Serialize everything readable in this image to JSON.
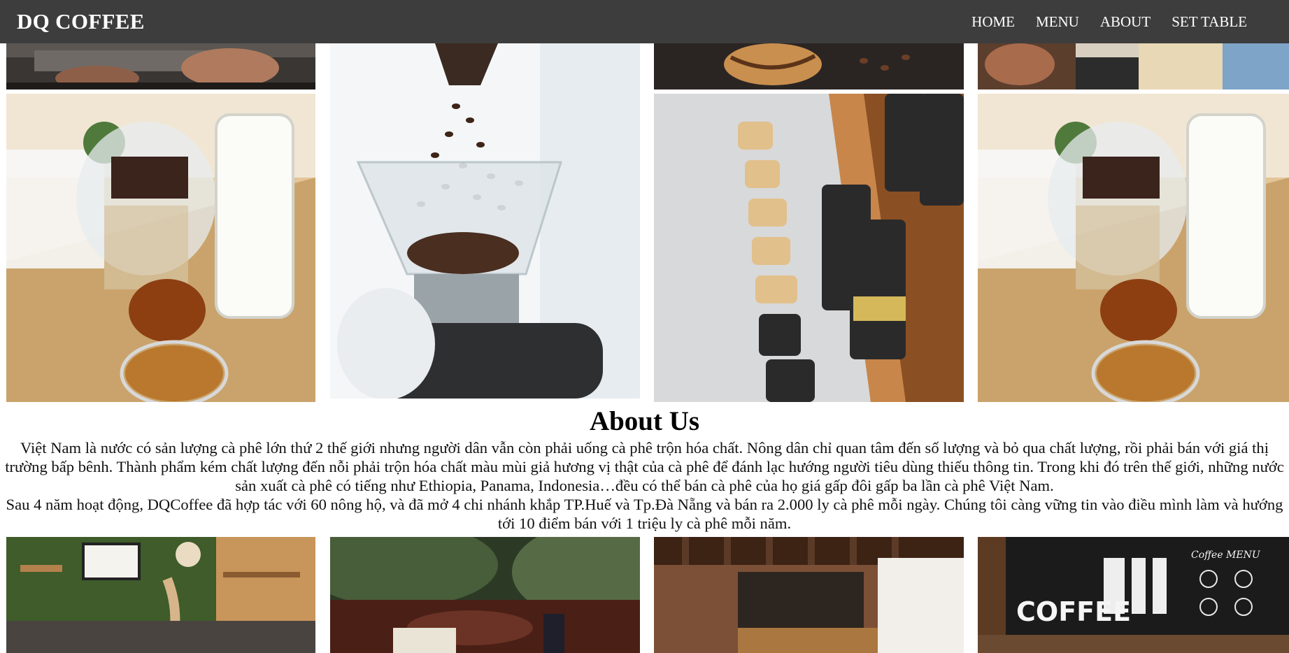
{
  "navbar": {
    "brand": "DQ COFFEE",
    "links": [
      "HOME",
      "MENU",
      "ABOUT",
      "SET TABLE"
    ],
    "background": "#3d3d3d"
  },
  "about": {
    "title": "About Us",
    "paragraph_1": "Việt Nam là nước có sản lượng cà phê lớn thứ 2 thế giới nhưng người dân vẫn còn phải uống cà phê trộn hóa chất. Nông dân chỉ quan tâm đến số lượng và bỏ qua chất lượng, rồi phải bán với giá thị trường bấp bênh. Thành phẩm kém chất lượng đến nỗi phải trộn hóa chất màu mùi giả hương vị thật của cà phê để đánh lạc hướng người tiêu dùng thiếu thông tin. Trong khi đó trên thế giới, những nước sản xuất cà phê có tiếng như Ethiopia, Panama, Indonesia…đều có thể bán cà phê của họ giá gấp đôi gấp ba lần cà phê Việt Nam.",
    "paragraph_2": "Sau 4 năm hoạt động, DQCoffee đã hợp tác với 60 nông hộ, và đã mở 4 chi nhánh khắp TP.Huế và Tp.Đà Nẵng và bán ra 2.000 ly cà phê mỗi ngày. Chúng tôi càng vững tin vào điều mình làm và hướng tới 10 điểm bán với 1 triệu ly cà phê mỗi năm."
  },
  "gallery": {
    "top_row": [
      "barista-hands-photo",
      "coffee-beans-grinder-photo",
      "croissant-beans-photo",
      "cashier-counter-photo"
    ],
    "middle_row": [
      "dessert-milk-tray-photo",
      "coffee-bean-pouring-photo",
      "coffee-bags-shelf-photo",
      "dessert-milk-tray-photo"
    ],
    "bottom_row": [
      "green-wall-cafe-interior-photo",
      "garden-terrace-table-photo",
      "brick-cafe-bar-photo",
      "chalkboard-coffee-menu-photo"
    ]
  },
  "photo_text": {
    "chalk_word": "COFFEE",
    "menu_word": "Coffee MENU"
  }
}
